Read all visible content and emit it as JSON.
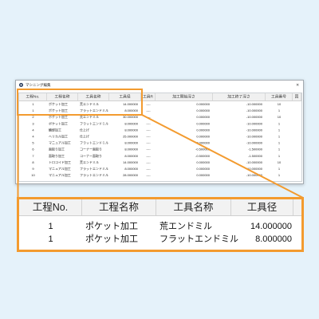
{
  "colors": {
    "accent": "#f39b2f",
    "background": "#e5f2fa"
  },
  "icons": {
    "app": "app-icon",
    "close": "close-icon"
  },
  "window": {
    "title": "マシニング編集",
    "close_label": "×",
    "columns": [
      "工程No.",
      "工程名称",
      "工具名称",
      "工具径",
      "工具R",
      "加工開始深さ",
      "加工終了深さ",
      "工具番号",
      "回"
    ],
    "rows": [
      [
        "1",
        "ポケット加工",
        "荒エンドミル",
        "14.000000",
        "----",
        "0.000000",
        "-10.000000",
        "10"
      ],
      [
        "1",
        "ポケット加工",
        "フラットエンドミル",
        "8.000000",
        "----",
        "0.000000",
        "-10.000000",
        "1"
      ],
      [
        "2",
        "ポケット加工",
        "荒エンドミル",
        "30.000000",
        "----",
        "0.000000",
        "-10.000000",
        "10"
      ],
      [
        "3",
        "ポケット加工",
        "フラットエンドミル",
        "8.000000",
        "----",
        "0.000000",
        "-10.000000",
        "1"
      ],
      [
        "4",
        "輪郭加工",
        "仕上げ",
        "8.000000",
        "----",
        "0.000000",
        "-10.000000",
        "1"
      ],
      [
        "4",
        "ヘリカル加工",
        "仕上げ",
        "25.000000",
        "----",
        "0.000000",
        "-10.000000",
        "1"
      ],
      [
        "5",
        "マニュアル加工",
        "フラットエンドミル",
        "8.000000",
        "----",
        "0.000000",
        "-10.000000",
        "1"
      ],
      [
        "6",
        "面取り加工",
        "コーナー面取り",
        "8.000000",
        "----",
        "-0.500000",
        "-1.500000",
        "1"
      ],
      [
        "7",
        "面取り加工",
        "コーナー面取り",
        "8.000000",
        "----",
        "-0.500000",
        "-1.500000",
        "1"
      ],
      [
        "8",
        "トロコイド加工",
        "荒エンドミル",
        "14.000000",
        "----",
        "0.000000",
        "-10.000000",
        "10"
      ],
      [
        "9",
        "マニュアル加工",
        "フラットエンドミル",
        "8.000000",
        "----",
        "0.000000",
        "-10.000000",
        "1"
      ],
      [
        "10",
        "マニュアル加工",
        "フラットエンドミル",
        "28.000000",
        "----",
        "0.000000",
        "-10.000000",
        "1"
      ]
    ]
  },
  "zoom": {
    "columns": [
      "工程No.",
      "工程名称",
      "工具名称",
      "工具径"
    ],
    "rows": [
      [
        "1",
        "ポケット加工",
        "荒エンドミル",
        "14.000000"
      ],
      [
        "1",
        "ポケット加工",
        "フラットエンドミル",
        "8.000000"
      ]
    ]
  }
}
